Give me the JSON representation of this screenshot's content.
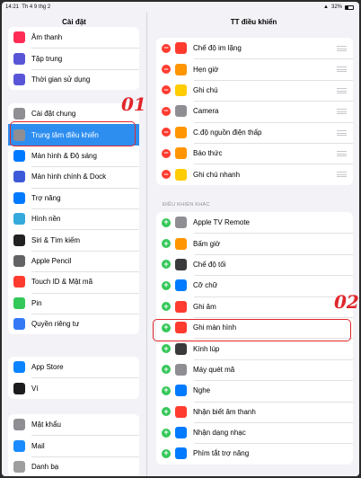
{
  "status": {
    "time": "14:21",
    "date": "Th 4 9 thg 2",
    "battery": "32%"
  },
  "sidebar": {
    "title": "Cài đặt",
    "group1": [
      {
        "label": "Âm thanh",
        "icon": "sound-icon",
        "color": "#ff2d55"
      },
      {
        "label": "Tập trung",
        "icon": "moon-icon",
        "color": "#5856d6"
      },
      {
        "label": "Thời gian sử dụng",
        "icon": "hourglass-icon",
        "color": "#5856d6"
      }
    ],
    "group2": [
      {
        "label": "Cài đặt chung",
        "icon": "gear-icon",
        "color": "#8e8e93"
      },
      {
        "label": "Trung tâm điều khiển",
        "icon": "control-center-icon",
        "color": "#8e8e93",
        "active": true
      },
      {
        "label": "Màn hình & Độ sáng",
        "icon": "display-icon",
        "color": "#007aff"
      },
      {
        "label": "Màn hình chính & Dock",
        "icon": "home-screen-icon",
        "color": "#3c5ad8"
      },
      {
        "label": "Trợ năng",
        "icon": "accessibility-icon",
        "color": "#007aff"
      },
      {
        "label": "Hình nền",
        "icon": "wallpaper-icon",
        "color": "#34aadc"
      },
      {
        "label": "Siri & Tìm kiếm",
        "icon": "siri-icon",
        "color": "#222222"
      },
      {
        "label": "Apple Pencil",
        "icon": "pencil-icon",
        "color": "#636366"
      },
      {
        "label": "Touch ID & Mật mã",
        "icon": "fingerprint-icon",
        "color": "#ff3b30"
      },
      {
        "label": "Pin",
        "icon": "battery-icon",
        "color": "#34c759"
      },
      {
        "label": "Quyền riêng tư",
        "icon": "hand-icon",
        "color": "#3478f6"
      }
    ],
    "group3": [
      {
        "label": "App Store",
        "icon": "appstore-icon",
        "color": "#0a84ff"
      },
      {
        "label": "Ví",
        "icon": "wallet-icon",
        "color": "#1c1c1e"
      }
    ],
    "group4": [
      {
        "label": "Mật khẩu",
        "icon": "key-icon",
        "color": "#8e8e93"
      },
      {
        "label": "Mail",
        "icon": "mail-icon",
        "color": "#1a8cff"
      },
      {
        "label": "Danh bạ",
        "icon": "contacts-icon",
        "color": "#9e9e9e"
      }
    ]
  },
  "main": {
    "title": "TT điều khiển",
    "included": [
      {
        "label": "Chế độ im lặng",
        "icon": "bell-icon",
        "color": "#ff3b30"
      },
      {
        "label": "Hẹn giờ",
        "icon": "alarm-icon",
        "color": "#ff9500"
      },
      {
        "label": "Ghi chú",
        "icon": "notes-icon",
        "color": "#ffcc00"
      },
      {
        "label": "Camera",
        "icon": "camera-icon",
        "color": "#8e8e93"
      },
      {
        "label": "C.độ nguồn điện thấp",
        "icon": "low-power-icon",
        "color": "#ff9500"
      },
      {
        "label": "Báo thức",
        "icon": "alarm-clock-icon",
        "color": "#ff9500"
      },
      {
        "label": "Ghi chú nhanh",
        "icon": "quick-note-icon",
        "color": "#ffcc00"
      }
    ],
    "more_label": "ĐIỀU KHIỂN KHÁC",
    "more": [
      {
        "label": "Apple TV Remote",
        "icon": "remote-icon",
        "color": "#8e8e93"
      },
      {
        "label": "Bấm giờ",
        "icon": "stopwatch-icon",
        "color": "#ff9500"
      },
      {
        "label": "Chế độ tối",
        "icon": "dark-mode-icon",
        "color": "#3a3a3c"
      },
      {
        "label": "Cỡ chữ",
        "icon": "text-size-icon",
        "color": "#007aff"
      },
      {
        "label": "Ghi âm",
        "icon": "voice-memo-icon",
        "color": "#ff3b30"
      },
      {
        "label": "Ghi màn hình",
        "icon": "screen-record-icon",
        "color": "#ff3b30"
      },
      {
        "label": "Kính lúp",
        "icon": "magnifier-icon",
        "color": "#3a3a3c"
      },
      {
        "label": "Máy quét mã",
        "icon": "qr-icon",
        "color": "#8e8e93"
      },
      {
        "label": "Nghe",
        "icon": "ear-icon",
        "color": "#007aff"
      },
      {
        "label": "Nhận biết âm thanh",
        "icon": "sound-recognition-icon",
        "color": "#ff3b30"
      },
      {
        "label": "Nhận dạng nhạc",
        "icon": "shazam-icon",
        "color": "#007aff"
      },
      {
        "label": "Phím tắt trợ năng",
        "icon": "accessibility-shortcut-icon",
        "color": "#007aff"
      }
    ]
  },
  "annotations": {
    "first": "01",
    "second": "02"
  }
}
